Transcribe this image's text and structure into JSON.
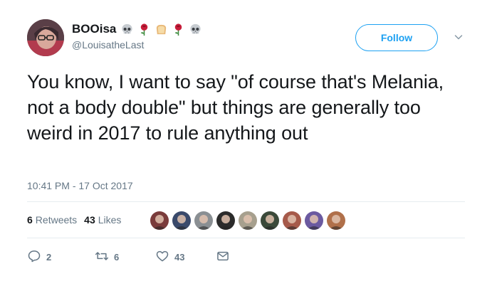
{
  "author": {
    "display_name": "BOOisa",
    "handle": "@LouisatheLast",
    "name_emojis": [
      "skull-icon",
      "rose-icon",
      "bread-icon",
      "rose-icon",
      "skull-icon"
    ]
  },
  "follow_label": "Follow",
  "tweet": {
    "text": "You know, I want to say \"of course that's Melania, not a body double\" but things are generally too weird in 2017 to rule anything out",
    "timestamp": "10:41 PM - 17 Oct 2017"
  },
  "stats": {
    "retweets_count": "6",
    "retweets_label": "Retweets",
    "likes_count": "43",
    "likes_label": "Likes"
  },
  "liker_avatar_colors": [
    "#7a3b3b",
    "#3a4a6b",
    "#8a8f93",
    "#2b2b2b",
    "#a7a08e",
    "#3b4a3a",
    "#a65a4a",
    "#6b5aa0",
    "#b0704a"
  ],
  "actions": {
    "replies": "2",
    "retweets": "6",
    "likes": "43"
  },
  "colors": {
    "accent": "#1da1f2",
    "muted": "#657786",
    "text": "#14171a"
  }
}
